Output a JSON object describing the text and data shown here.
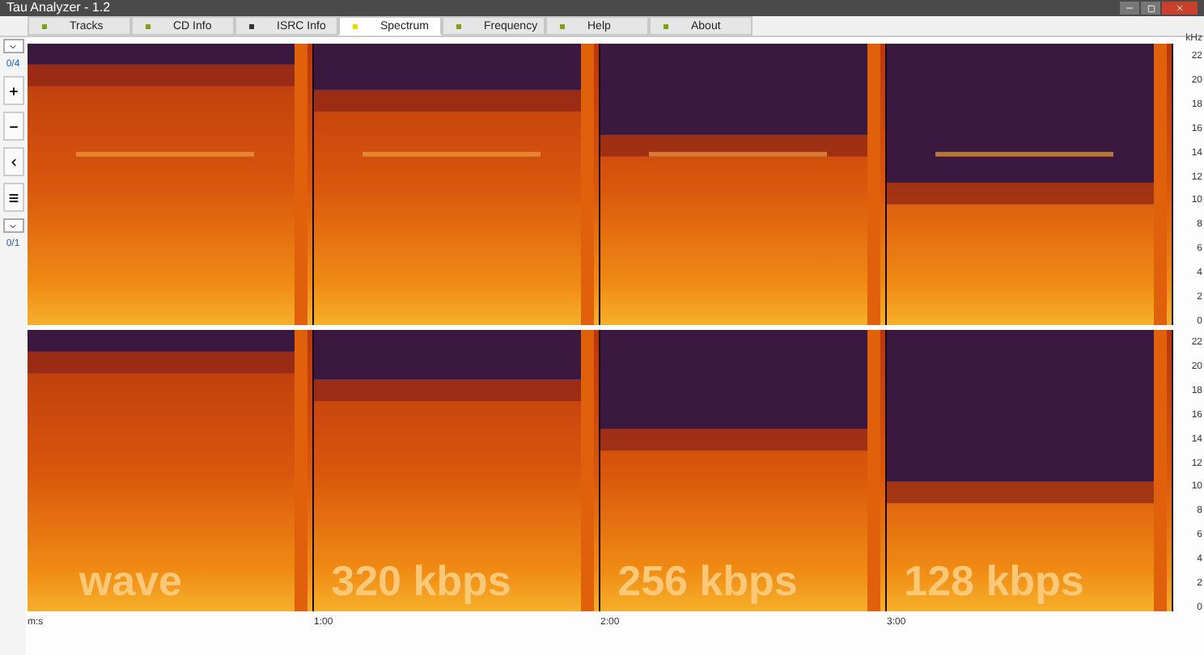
{
  "window": {
    "title": "Tau Analyzer - 1.2"
  },
  "tabs": [
    {
      "label": "Tracks",
      "selected": false,
      "color": "#7aa21c"
    },
    {
      "label": "CD Info",
      "selected": false,
      "color": "#7aa21c"
    },
    {
      "label": "ISRC Info",
      "selected": false,
      "color": "#333333"
    },
    {
      "label": "Spectrum",
      "selected": true,
      "color": "#e6d800"
    },
    {
      "label": "Frequency",
      "selected": false,
      "color": "#7aa21c"
    },
    {
      "label": "Help",
      "selected": false,
      "color": "#7aa21c"
    },
    {
      "label": "About",
      "selected": false,
      "color": "#7aa21c"
    }
  ],
  "sidebar": {
    "track_counter": "0/4",
    "channel_counter": "0/1"
  },
  "spectrum": {
    "frequency_unit": "kHz",
    "channels": [
      {
        "frequency_ticks": [
          "22",
          "20",
          "18",
          "16",
          "14",
          "12",
          "10",
          "8",
          "6",
          "4",
          "2",
          "0"
        ]
      },
      {
        "frequency_ticks": [
          "22",
          "20",
          "18",
          "16",
          "14",
          "12",
          "10",
          "8",
          "6",
          "4",
          "2",
          "0"
        ]
      }
    ],
    "segment_labels": [
      "wave",
      "320 kbps",
      "256 kbps",
      "128 kbps"
    ],
    "time_ticks": [
      "m:s",
      "1:00",
      "2:00",
      "3:00"
    ]
  }
}
